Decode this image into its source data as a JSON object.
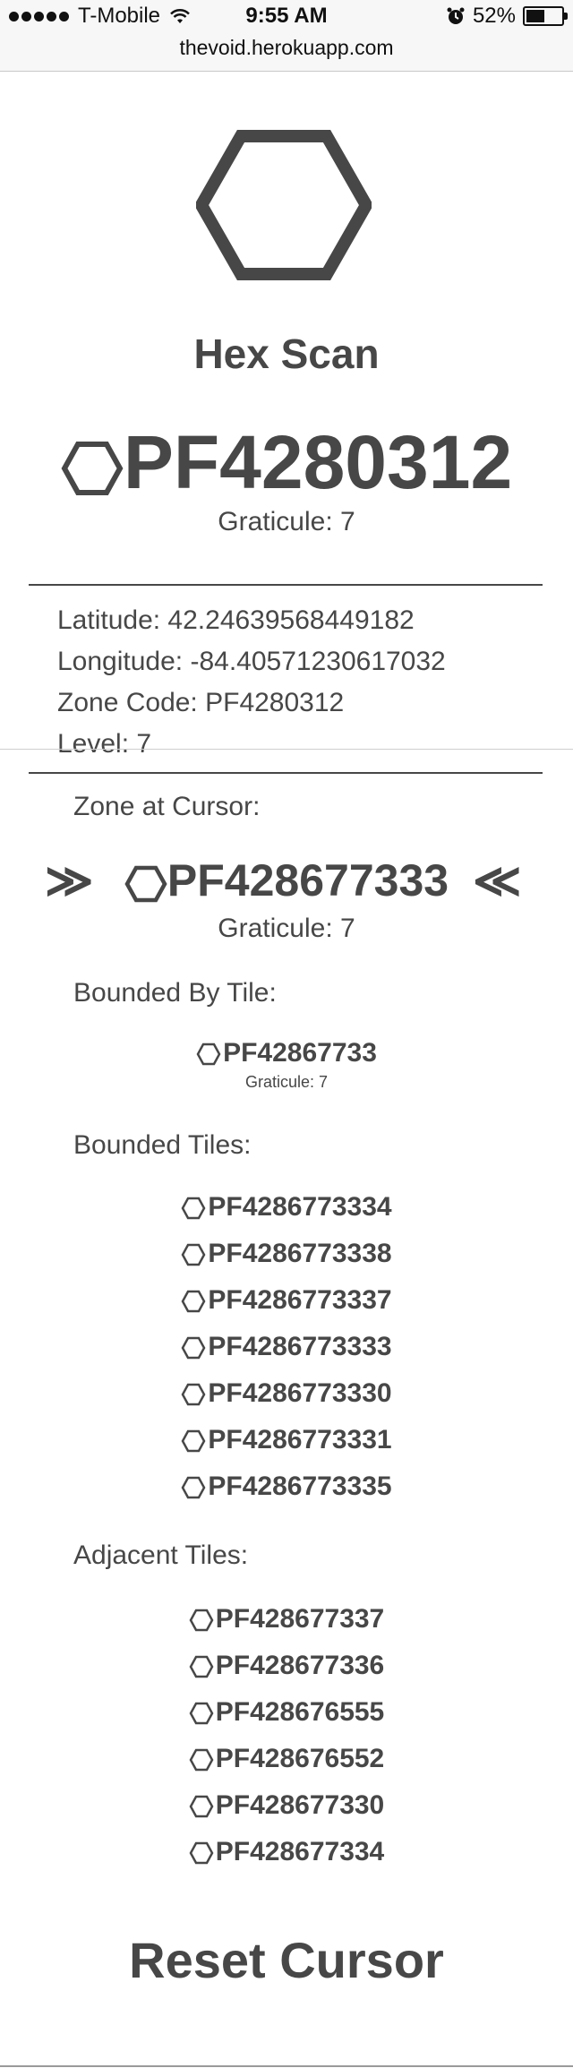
{
  "status_bar": {
    "carrier": "T-Mobile",
    "time": "9:55 AM",
    "battery": "52%",
    "battery_level": 0.52
  },
  "url_bar": {
    "url": "thevoid.herokuapp.com"
  },
  "page": {
    "title": "Hex Scan",
    "zone_code_display": "PF4280312",
    "graticule_label": "Graticule: 7",
    "details": {
      "latitude": "Latitude: 42.24639568449182",
      "longitude": "Longitude: -84.40571230617032",
      "zone_code": "Zone Code: PF4280312",
      "level": "Level: 7"
    },
    "cursor": {
      "label": "Zone at Cursor:",
      "left_chevron": "≫",
      "right_chevron": "≪",
      "code": "PF428677333",
      "graticule_label": "Graticule: 7"
    },
    "bounded_by": {
      "label": "Bounded By Tile:",
      "code": "PF42867733",
      "graticule_label": "Graticule: 7"
    },
    "bounded_tiles": {
      "label": "Bounded Tiles:",
      "items": [
        "PF4286773334",
        "PF4286773338",
        "PF4286773337",
        "PF4286773333",
        "PF4286773330",
        "PF4286773331",
        "PF4286773335"
      ]
    },
    "adjacent_tiles": {
      "label": "Adjacent Tiles:",
      "items": [
        "PF428677337",
        "PF428677336",
        "PF428676555",
        "PF428676552",
        "PF428677330",
        "PF428677334"
      ]
    },
    "reset_button": "Reset Cursor"
  },
  "colors": {
    "text": "#474747",
    "rule": "#474747"
  },
  "icons": {
    "hexagon": "hexagon-icon"
  }
}
